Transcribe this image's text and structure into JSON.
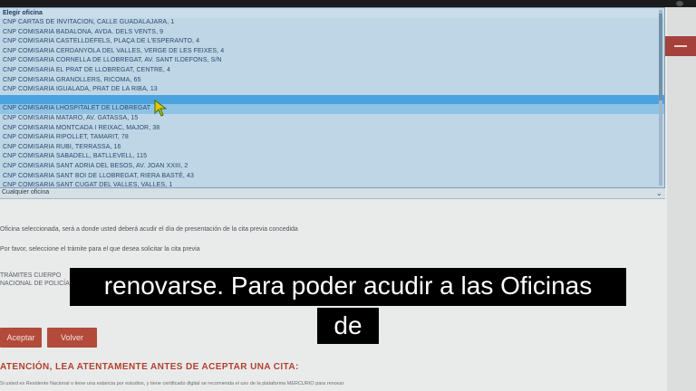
{
  "dropdown": {
    "header": "Elegir oficina",
    "items": [
      "CNP CARTAS DE INVITACION, CALLE GUADALAJARA, 1",
      "CNP COMISARIA BADALONA, AVDA. DELS VENTS, 9",
      "CNP COMISARIA CASTELLDEFELS, PLAÇA DE L'ESPERANTO, 4",
      "CNP COMISARIA CERDANYOLA DEL VALLES, VERGE DE LES FEIXES, 4",
      "CNP COMISARIA CORNELLA DE LLOBREGAT, AV. SANT ILDEFONS, S/N",
      "CNP COMISARIA EL PRAT DE LLOBREGAT, CENTRE, 4",
      "CNP COMISARIA GRANOLLERS, RICOMA, 65",
      "CNP COMISARIA IGUALADA, PRAT DE LA RIBA, 13",
      "",
      "CNP COMISARIA LHOSPITALET DE LLOBREGAT",
      "CNP COMISARIA MATARO, AV. GATASSA, 15",
      "CNP COMISARIA MONTCADA I REIXAC, MAJOR, 38",
      "CNP COMISARIA RIPOLLET, TAMARIT, 78",
      "CNP COMISARIA RUBI, TERRASSA, 16",
      "CNP COMISARIA SABADELL, BATLLEVELL, 115",
      "CNP COMISARIA SANT ADRIA DEL BESOS, AV. JOAN XXIII, 2",
      "CNP COMISARIA SANT BOI DE LLOBREGAT, RIERA BASTÉ, 43",
      "CNP COMISARIA SANT CUGAT DEL VALLES, VALLES, 1"
    ],
    "highlighted_index": 8
  },
  "select": {
    "value": "Cualquier oficina"
  },
  "form": {
    "office_note": "Oficina seleccionada, será a donde usted deberá acudir el día de presentación de la cita previa concedida",
    "tramite_prompt": "Por favor, seleccione el trámite para el que desea solicitar la cita previa",
    "section_line1": "TRÁMITES CUERPO",
    "section_line2": "NACIONAL DE POLICÍA"
  },
  "buttons": {
    "accept": "Aceptar",
    "back": "Volver"
  },
  "notice": {
    "heading": "ATENCIÓN, LEA ATENTAMENTE ANTES DE ACEPTAR UNA CITA:",
    "footnote": "Si usted es Residente Nacional o tiene una estancia por estudios, y tiene certificado digital se recomienda el uso de la plataforma MERCURIO para renovar"
  },
  "captions": {
    "line1": "renovarse. Para poder acudir a las Oficinas",
    "line2": "de"
  },
  "colors": {
    "accent_red": "#b34b3b",
    "dropdown_bg": "#bfd6e6",
    "highlight": "#4aa3df"
  }
}
